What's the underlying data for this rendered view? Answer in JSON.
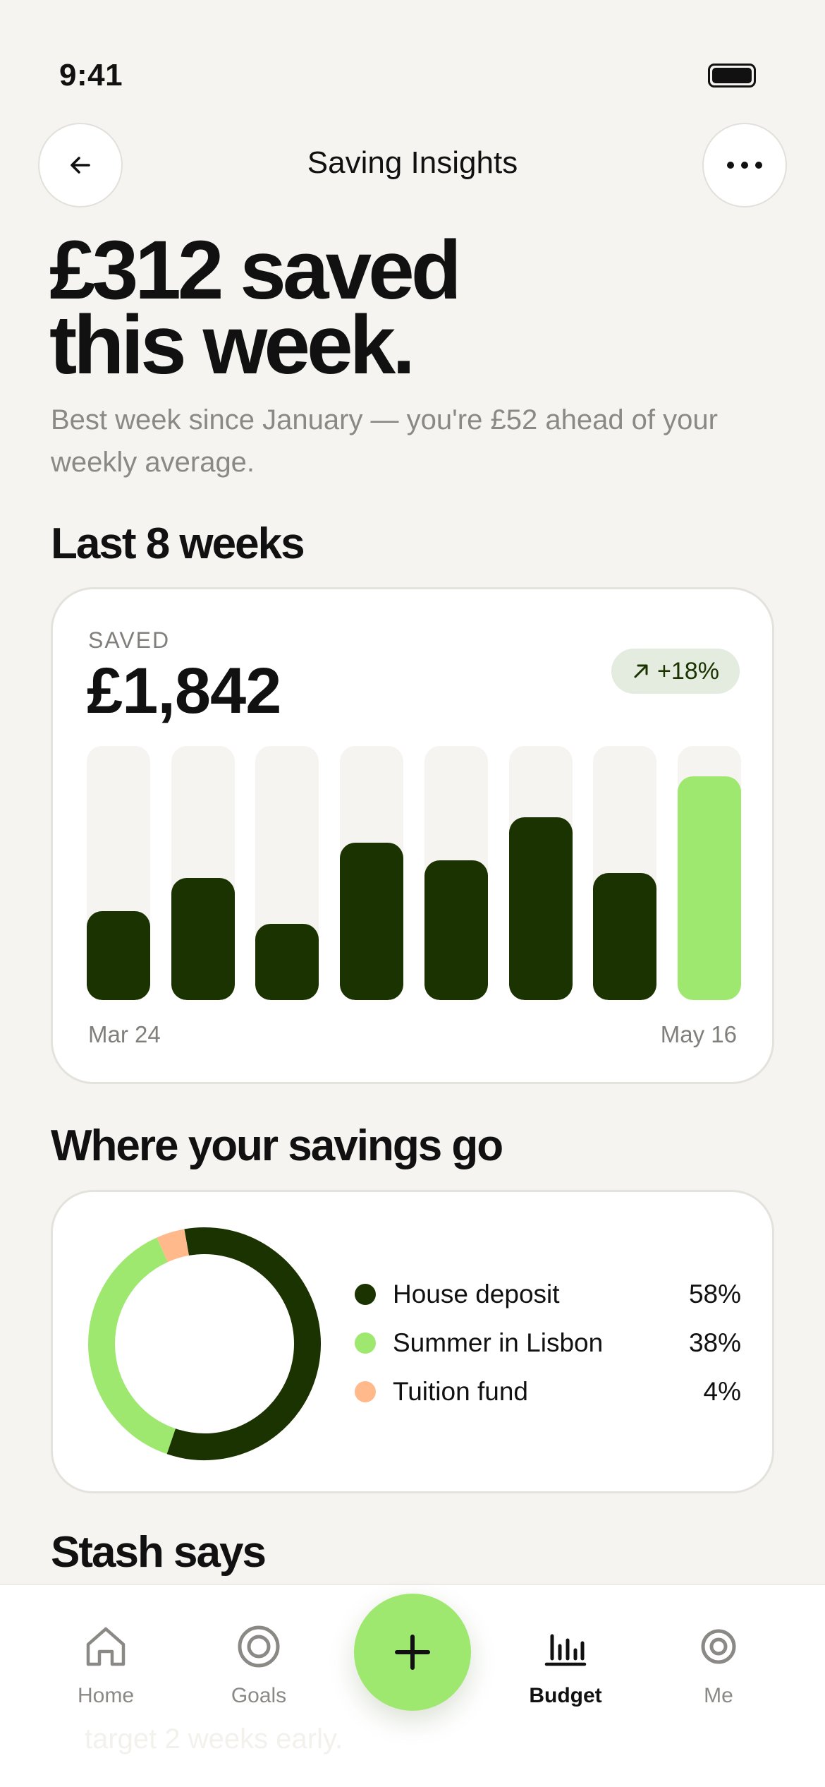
{
  "status_bar": {
    "time": "9:41"
  },
  "nav": {
    "title": "Saving Insights",
    "back_icon": "arrow-left-icon",
    "more_icon": "ellipsis-icon"
  },
  "hero": {
    "headline_line1": "£312 saved",
    "headline_line2": "this week.",
    "subtext": "Best week since January — you're £52 ahead of your weekly average."
  },
  "last_weeks": {
    "section_title": "Last 8 weeks",
    "saved_label": "SAVED",
    "saved_value": "£1,842",
    "trend_icon": "arrow-up-right-icon",
    "trend": "+18%",
    "axis_start": "Mar 24",
    "axis_end": "May 16"
  },
  "chart_data": {
    "type": "bar",
    "categories": [
      "1",
      "2",
      "3",
      "4",
      "5",
      "6",
      "7",
      "8"
    ],
    "values": [
      0.35,
      0.48,
      0.3,
      0.62,
      0.55,
      0.72,
      0.5,
      0.88
    ],
    "ylim": [
      0,
      1
    ],
    "grid": false,
    "colors": {
      "past": "#1a3300",
      "current": "#9fe870",
      "track": "#f5f4f0"
    }
  },
  "where": {
    "section_title": "Where your savings go",
    "items": [
      {
        "name": "House deposit",
        "pct": "58%",
        "value": 58,
        "color": "#1a3300"
      },
      {
        "name": "Summer in Lisbon",
        "pct": "38%",
        "value": 38,
        "color": "#9fe870"
      },
      {
        "name": "Tuition fund",
        "pct": "4%",
        "value": 4,
        "color": "#ffb98a"
      }
    ]
  },
  "stash": {
    "section_title": "Stash says",
    "peek_text": "target 2 weeks early."
  },
  "tabbar": {
    "tabs": [
      {
        "label": "Home",
        "icon": "home-icon"
      },
      {
        "label": "Goals",
        "icon": "target-icon"
      },
      {
        "label": "Budget",
        "icon": "bar-chart-icon"
      },
      {
        "label": "Me",
        "icon": "person-icon"
      }
    ],
    "active": "Budget",
    "fab_icon": "plus-icon"
  },
  "colors": {
    "accent": "#9fe870",
    "dark": "#1a3300",
    "background": "#f5f4f0"
  }
}
